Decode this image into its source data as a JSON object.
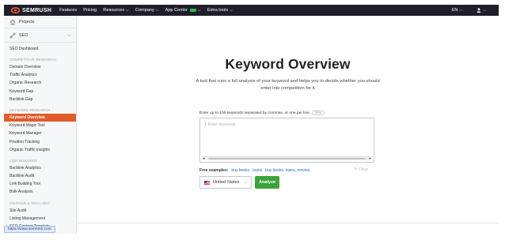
{
  "topbar": {
    "brand": "SEMRUSH",
    "nav": [
      {
        "label": "Features",
        "has_menu": false
      },
      {
        "label": "Pricing",
        "has_menu": false
      },
      {
        "label": "Resources",
        "has_menu": true
      },
      {
        "label": "Company",
        "has_menu": true
      },
      {
        "label": "App Center",
        "has_menu": true
      },
      {
        "label": "Extra tools",
        "has_menu": true
      }
    ],
    "language": "EN",
    "chevron": "⌵"
  },
  "sidebar": {
    "projects": "Projects",
    "seo": "SEO",
    "dashboard": "SEO Dashboard",
    "sections": [
      {
        "title": "COMPETITIVE RESEARCH",
        "items": [
          "Domain Overview",
          "Traffic Analytics",
          "Organic Research",
          "Keyword Gap",
          "Backlink Gap"
        ]
      },
      {
        "title": "KEYWORD RESEARCH",
        "items": [
          "Keyword Overview",
          "Keyword Magic Tool",
          "Keyword Manager",
          "Position Tracking",
          "Organic Traffic Insights"
        ]
      },
      {
        "title": "LINK BUILDING",
        "items": [
          "Backlink Analytics",
          "Backlink Audit",
          "Link Building Tool",
          "Bulk Analysis"
        ]
      },
      {
        "title": "ON PAGE & TECH SEO",
        "items": [
          "Site Audit",
          "Listing Management",
          "SEO Content Template"
        ]
      }
    ],
    "active_item": "Keyword Overview",
    "active_color": "#e25b2a"
  },
  "main": {
    "title": "Keyword Overview",
    "description": "A tool that runs a full analysis of your keyword and helps you to decide whether you should enter into competition for it",
    "input_label": "Enter up to 100 keywords separated by commas, or one per line",
    "spm_badge": "SPM",
    "line_number": "1",
    "placeholder": "Enter keywords",
    "examples_label": "Free examples:",
    "examples": [
      "buy books",
      "loans",
      "buy books, loans, movies"
    ],
    "clear_label": "Clear",
    "database": "United States",
    "analyze_label": "Analyze",
    "analyze_color": "#3ca33a"
  },
  "status_url": "https://www.semrush.com"
}
